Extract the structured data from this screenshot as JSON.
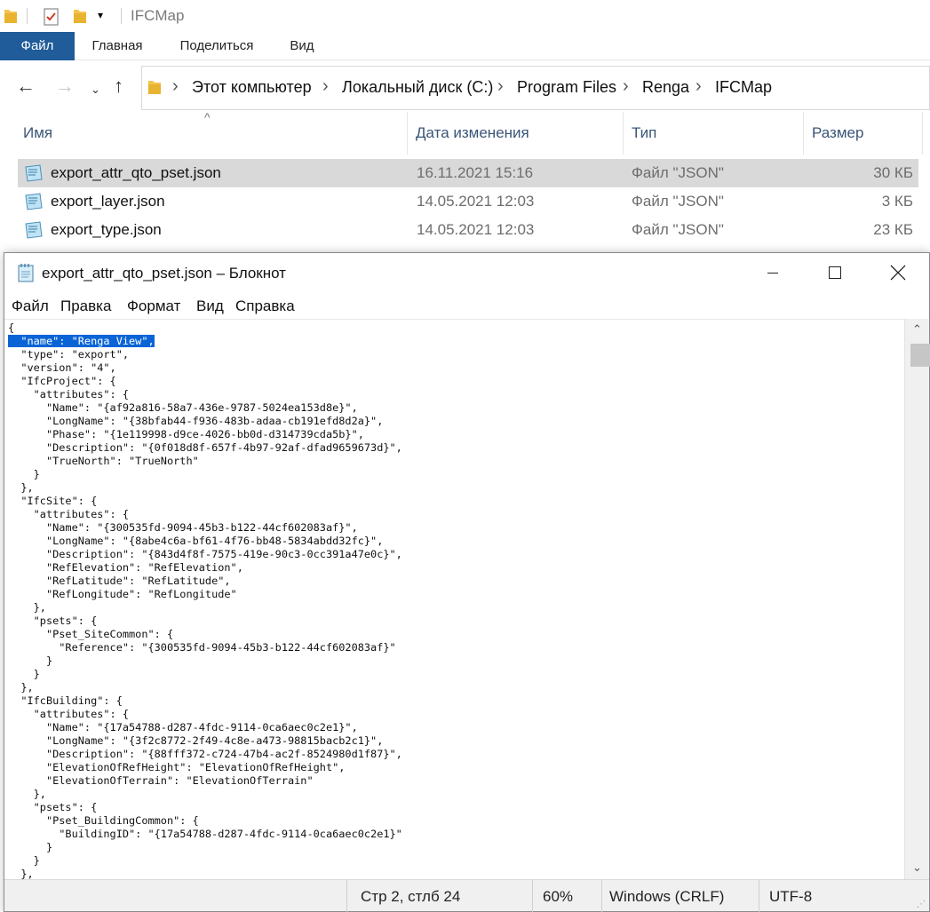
{
  "explorer": {
    "title": "IFCMap",
    "ribbon_tabs": [
      "Файл",
      "Главная",
      "Поделиться",
      "Вид"
    ],
    "breadcrumb": [
      "Этот компьютер",
      "Локальный диск (C:)",
      "Program Files",
      "Renga",
      "IFCMap"
    ],
    "columns": {
      "name": "Имя",
      "date": "Дата изменения",
      "type": "Тип",
      "size": "Размер"
    },
    "files": [
      {
        "name": "export_attr_qto_pset.json",
        "date": "16.11.2021 15:16",
        "type": "Файл \"JSON\"",
        "size": "30 КБ",
        "selected": true
      },
      {
        "name": "export_layer.json",
        "date": "14.05.2021 12:03",
        "type": "Файл \"JSON\"",
        "size": "3 КБ",
        "selected": false
      },
      {
        "name": "export_type.json",
        "date": "14.05.2021 12:03",
        "type": "Файл \"JSON\"",
        "size": "23 КБ",
        "selected": false
      }
    ],
    "icons": {
      "folder": "folder-icon",
      "properties": "properties-checkmark-icon",
      "json_file": "json-file-icon"
    },
    "accent_color": "#1f5c99"
  },
  "notepad": {
    "title": "export_attr_qto_pset.json – Блокнот",
    "menu": [
      "Файл",
      "Правка",
      "Формат",
      "Вид",
      "Справка"
    ],
    "selected_text": "  \"name\": \"Renga View\",",
    "content_lines": [
      "{",
      "  \"name\": \"Renga View\",",
      "  \"type\": \"export\",",
      "  \"version\": \"4\",",
      "  \"IfcProject\": {",
      "    \"attributes\": {",
      "      \"Name\": \"{af92a816-58a7-436e-9787-5024ea153d8e}\",",
      "      \"LongName\": \"{38bfab44-f936-483b-adaa-cb191efd8d2a}\",",
      "      \"Phase\": \"{1e119998-d9ce-4026-bb0d-d314739cda5b}\",",
      "      \"Description\": \"{0f018d8f-657f-4b97-92af-dfad9659673d}\",",
      "      \"TrueNorth\": \"TrueNorth\"",
      "    }",
      "  },",
      "  \"IfcSite\": {",
      "    \"attributes\": {",
      "      \"Name\": \"{300535fd-9094-45b3-b122-44cf602083af}\",",
      "      \"LongName\": \"{8abe4c6a-bf61-4f76-bb48-5834abdd32fc}\",",
      "      \"Description\": \"{843d4f8f-7575-419e-90c3-0cc391a47e0c}\",",
      "      \"RefElevation\": \"RefElevation\",",
      "      \"RefLatitude\": \"RefLatitude\",",
      "      \"RefLongitude\": \"RefLongitude\"",
      "    },",
      "    \"psets\": {",
      "      \"Pset_SiteCommon\": {",
      "        \"Reference\": \"{300535fd-9094-45b3-b122-44cf602083af}\"",
      "      }",
      "    }",
      "  },",
      "  \"IfcBuilding\": {",
      "    \"attributes\": {",
      "      \"Name\": \"{17a54788-d287-4fdc-9114-0ca6aec0c2e1}\",",
      "      \"LongName\": \"{3f2c8772-2f49-4c8e-a473-98815bacb2c1}\",",
      "      \"Description\": \"{88fff372-c724-47b4-ac2f-8524980d1f87}\",",
      "      \"ElevationOfRefHeight\": \"ElevationOfRefHeight\",",
      "      \"ElevationOfTerrain\": \"ElevationOfTerrain\"",
      "    },",
      "    \"psets\": {",
      "      \"Pset_BuildingCommon\": {",
      "        \"BuildingID\": \"{17a54788-d287-4fdc-9114-0ca6aec0c2e1}\"",
      "      }",
      "    }",
      "  },"
    ],
    "status": {
      "position": "Стр 2, стлб 24",
      "zoom": "60%",
      "line_ending": "Windows (CRLF)",
      "encoding": "UTF-8"
    },
    "selection_color": "#0a64d6"
  }
}
